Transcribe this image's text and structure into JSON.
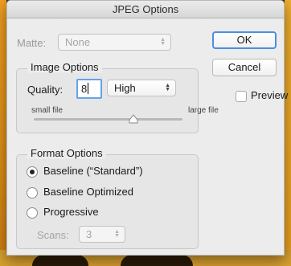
{
  "window": {
    "title": "JPEG Options"
  },
  "matte": {
    "label": "Matte:",
    "value": "None",
    "enabled": false
  },
  "buttons": {
    "ok": "OK",
    "cancel": "Cancel"
  },
  "preview": {
    "label": "Preview",
    "checked": false
  },
  "image_options": {
    "title": "Image Options",
    "quality_label": "Quality:",
    "quality_value": "8",
    "quality_preset": "High",
    "slider_min_label": "small file",
    "slider_max_label": "large file",
    "slider_fraction": 0.67
  },
  "format_options": {
    "title": "Format Options",
    "options": [
      {
        "label": "Baseline (“Standard”)",
        "selected": true
      },
      {
        "label": "Baseline Optimized",
        "selected": false
      },
      {
        "label": "Progressive",
        "selected": false
      }
    ],
    "scans_label": "Scans:",
    "scans_value": "3",
    "scans_enabled": false
  },
  "colors": {
    "focus_ring": "#4b8fe0",
    "dialog_bg": "#ececec"
  }
}
